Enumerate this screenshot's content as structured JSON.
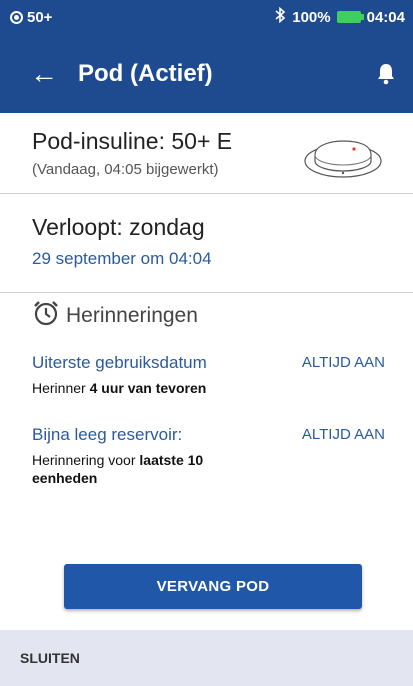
{
  "status_bar": {
    "pod_status": "50+",
    "bluetooth_icon": "bluetooth-icon",
    "battery_percent": "100%",
    "time": "04:04",
    "battery_color": "#3fcf5a"
  },
  "header": {
    "back_icon": "arrow-left-icon",
    "title": "Pod (Actief)",
    "bell_icon": "bell-icon",
    "background": "#1e4b8f"
  },
  "insulin": {
    "label": "Pod-insuline: 50+ E",
    "updated": "(Vandaag, 04:05 bijgewerkt)"
  },
  "expiry": {
    "label": "Verloopt: zondag",
    "date": "29 september om 04:04"
  },
  "reminders": {
    "title": "Herinneringen",
    "icon": "alarm-clock-icon",
    "items": [
      {
        "title": "Uiterste gebruiksdatum",
        "status": "ALTIJD AAN",
        "desc_prefix": "Herinner ",
        "desc_bold": "4 uur van tevoren"
      },
      {
        "title": "Bijna leeg reservoir:",
        "status": "ALTIJD AAN",
        "desc_prefix": "Herinnering voor ",
        "desc_bold": "laatste 10 eenheden"
      }
    ]
  },
  "actions": {
    "replace_label": "VERVANG POD",
    "close_label": "SLUITEN"
  }
}
